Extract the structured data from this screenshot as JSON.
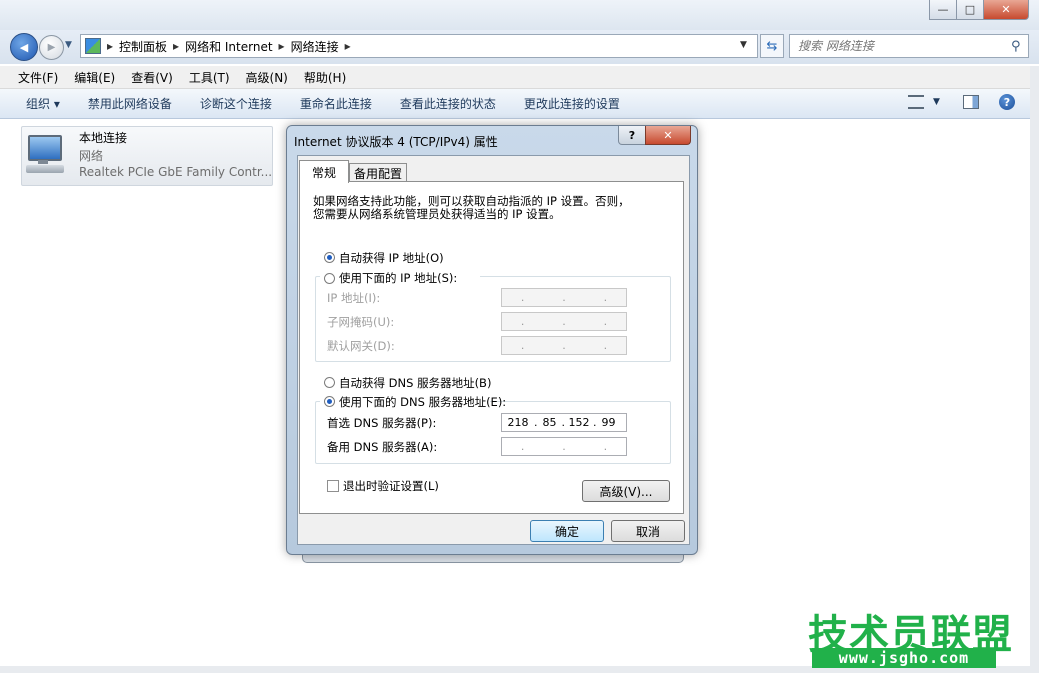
{
  "window": {
    "minimize_glyph": "—",
    "maximize_glyph": "□",
    "close_glyph": "✕"
  },
  "nav": {
    "back_glyph": "◀",
    "forward_glyph": "▶",
    "breadcrumb": [
      "控制面板",
      "网络和 Internet",
      "网络连接"
    ],
    "separator": "▸",
    "search_placeholder": "搜索 网络连接"
  },
  "menu": [
    "文件(F)",
    "编辑(E)",
    "查看(V)",
    "工具(T)",
    "高级(N)",
    "帮助(H)"
  ],
  "toolbar": {
    "organize": "组织 ▾",
    "items": [
      "禁用此网络设备",
      "诊断这个连接",
      "重命名此连接",
      "查看此连接的状态",
      "更改此连接的设置"
    ]
  },
  "connection": {
    "name": "本地连接",
    "network": "网络",
    "adapter": "Realtek PCIe GbE Family Contr..."
  },
  "dialog": {
    "title": "Internet 协议版本 4 (TCP/IPv4) 属性",
    "help_glyph": "?",
    "close_glyph": "✕",
    "tabs": [
      "常规",
      "备用配置"
    ],
    "intro_line1": "如果网络支持此功能，则可以获取自动指派的 IP 设置。否则，",
    "intro_line2": "您需要从网络系统管理员处获得适当的 IP 设置。",
    "ip_auto": "自动获得 IP 地址(O)",
    "ip_manual": "使用下面的 IP 地址(S):",
    "ip_address_label": "IP 地址(I):",
    "subnet_label": "子网掩码(U):",
    "gateway_label": "默认网关(D):",
    "dns_auto": "自动获得 DNS 服务器地址(B)",
    "dns_manual": "使用下面的 DNS 服务器地址(E):",
    "preferred_dns_label": "首选 DNS 服务器(P):",
    "preferred_dns": [
      "218",
      "85",
      "152",
      "99"
    ],
    "alternate_dns_label": "备用 DNS 服务器(A):",
    "validate_label": "退出时验证设置(L)",
    "advanced_button": "高级(V)...",
    "ok_button": "确定",
    "cancel_button": "取消",
    "ip_auto_selected": true,
    "dns_manual_selected": true,
    "validate_checked": false
  },
  "watermark": {
    "text": "技术员联盟",
    "url": "www.jsgho.com"
  },
  "colors": {
    "watermark_green": "#21b14a",
    "toolbar_text": "#1e395b",
    "radio_dot": "#1f5dbf"
  }
}
